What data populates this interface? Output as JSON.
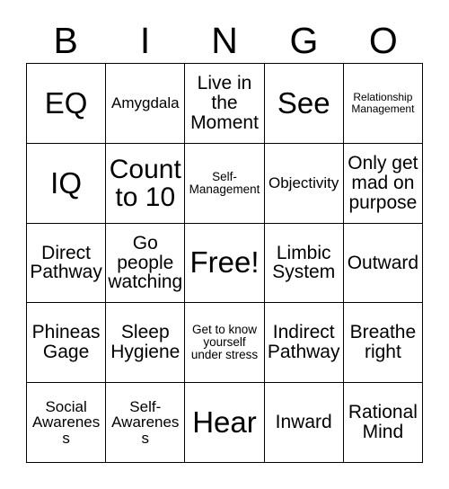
{
  "card": {
    "title": "Bingo Card",
    "header_letters": [
      "B",
      "I",
      "N",
      "G",
      "O"
    ],
    "grid_size": "5x5",
    "colors": {
      "background": "#ffffff",
      "text": "#000000",
      "border": "#000000"
    },
    "rows": [
      [
        {
          "text": "EQ",
          "size": "xl"
        },
        {
          "text": "Amygdala",
          "size": "sm"
        },
        {
          "text": "Live in the Moment",
          "size": "md"
        },
        {
          "text": "See",
          "size": "xl"
        },
        {
          "text": "Relationship Management",
          "size": "xxs"
        }
      ],
      [
        {
          "text": "IQ",
          "size": "xl"
        },
        {
          "text": "Count to 10",
          "size": "lg"
        },
        {
          "text": "Self-Management",
          "size": "xs"
        },
        {
          "text": "Objectivity",
          "size": "sm"
        },
        {
          "text": "Only get mad on purpose",
          "size": "md"
        }
      ],
      [
        {
          "text": "Direct Pathway",
          "size": "md"
        },
        {
          "text": "Go people watching",
          "size": "md"
        },
        {
          "text": "Free!",
          "size": "xl"
        },
        {
          "text": "Limbic System",
          "size": "md"
        },
        {
          "text": "Outward",
          "size": "md"
        }
      ],
      [
        {
          "text": "Phineas Gage",
          "size": "md"
        },
        {
          "text": "Sleep Hygiene",
          "size": "md"
        },
        {
          "text": "Get to know yourself under stress",
          "size": "xs"
        },
        {
          "text": "Indirect Pathway",
          "size": "md"
        },
        {
          "text": "Breathe right",
          "size": "md"
        }
      ],
      [
        {
          "text": "Social Awareness",
          "size": "sm"
        },
        {
          "text": "Self-Awareness",
          "size": "sm"
        },
        {
          "text": "Hear",
          "size": "xl"
        },
        {
          "text": "Inward",
          "size": "md"
        },
        {
          "text": "Rational Mind",
          "size": "md"
        }
      ]
    ]
  }
}
